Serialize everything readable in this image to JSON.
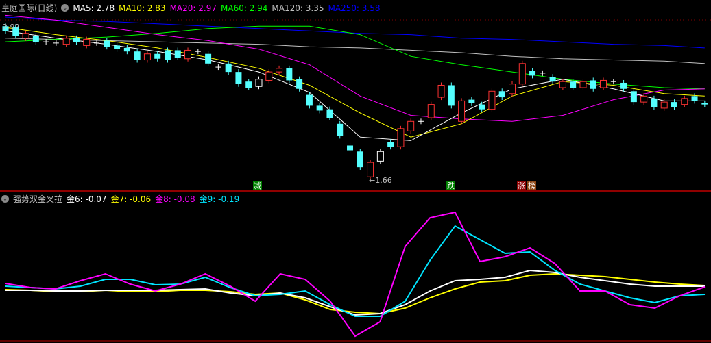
{
  "header": {
    "title": "皇庭国际(日线)",
    "ma": [
      {
        "label": "MA5: 2.78",
        "color": "#ffffff"
      },
      {
        "label": "MA10: 2.83",
        "color": "#ffff00"
      },
      {
        "label": "MA20: 2.97",
        "color": "#ff00ff"
      },
      {
        "label": "MA60: 2.94",
        "color": "#00ff00"
      },
      {
        "label": "MA120: 3.35",
        "color": "#c0c0c0"
      },
      {
        "label": "MA250: 3.58",
        "color": "#0000ff"
      }
    ]
  },
  "price_labels": {
    "high": "2.92",
    "low": "←1.66"
  },
  "markers": [
    {
      "text": "减",
      "bg": "#008000"
    },
    {
      "text": "跌",
      "bg": "#008000"
    },
    {
      "text": "涨",
      "bg": "#8b0000"
    },
    {
      "text": "榜",
      "bg": "#8b4513"
    }
  ],
  "indicator": {
    "title": "强势双金叉拉",
    "lines": [
      {
        "label": "金6: -0.07",
        "color": "#ffffff"
      },
      {
        "label": "金7: -0.06",
        "color": "#ffff00"
      },
      {
        "label": "金8: -0.08",
        "color": "#ff00ff"
      },
      {
        "label": "金9: -0.19",
        "color": "#00e5ff"
      }
    ]
  },
  "colors": {
    "up": "#ff3232",
    "down": "#54ffff",
    "doji": "#ffffff",
    "separator": "#c00000"
  },
  "price_range": [
    1.55,
    3.05
  ],
  "candles": [
    [
      2.93,
      2.89,
      "d"
    ],
    [
      2.92,
      2.85,
      "d"
    ],
    [
      2.83,
      2.87,
      "u"
    ],
    [
      2.85,
      2.8,
      "d"
    ],
    [
      2.8,
      2.8,
      "x"
    ],
    [
      2.79,
      2.79,
      "x"
    ],
    [
      2.78,
      2.83,
      "u"
    ],
    [
      2.83,
      2.8,
      "d"
    ],
    [
      2.77,
      2.82,
      "u"
    ],
    [
      2.79,
      2.79,
      "x"
    ],
    [
      2.81,
      2.76,
      "d"
    ],
    [
      2.77,
      2.74,
      "d"
    ],
    [
      2.75,
      2.72,
      "d"
    ],
    [
      2.72,
      2.65,
      "d"
    ],
    [
      2.65,
      2.7,
      "u"
    ],
    [
      2.7,
      2.66,
      "d"
    ],
    [
      2.73,
      2.65,
      "d"
    ],
    [
      2.73,
      2.67,
      "d"
    ],
    [
      2.66,
      2.73,
      "u"
    ],
    [
      2.72,
      2.72,
      "x"
    ],
    [
      2.7,
      2.62,
      "d"
    ],
    [
      2.59,
      2.59,
      "x"
    ],
    [
      2.62,
      2.55,
      "d"
    ],
    [
      2.55,
      2.45,
      "d"
    ],
    [
      2.47,
      2.42,
      "d"
    ],
    [
      2.43,
      2.49,
      "w"
    ],
    [
      2.48,
      2.55,
      "u"
    ],
    [
      2.55,
      2.58,
      "u"
    ],
    [
      2.58,
      2.48,
      "d"
    ],
    [
      2.49,
      2.41,
      "d"
    ],
    [
      2.36,
      2.27,
      "d"
    ],
    [
      2.27,
      2.23,
      "d"
    ],
    [
      2.24,
      2.17,
      "d"
    ],
    [
      2.12,
      2.02,
      "d"
    ],
    [
      1.94,
      1.9,
      "d"
    ],
    [
      1.89,
      1.76,
      "d"
    ],
    [
      1.68,
      1.8,
      "u"
    ],
    [
      1.81,
      1.89,
      "w"
    ],
    [
      1.97,
      1.93,
      "d"
    ],
    [
      1.93,
      2.08,
      "u"
    ],
    [
      2.06,
      2.14,
      "u"
    ],
    [
      2.14,
      2.14,
      "x"
    ],
    [
      2.17,
      2.28,
      "u"
    ],
    [
      2.34,
      2.44,
      "u"
    ],
    [
      2.44,
      2.27,
      "d"
    ],
    [
      2.14,
      2.31,
      "u"
    ],
    [
      2.32,
      2.29,
      "d"
    ],
    [
      2.28,
      2.24,
      "d"
    ],
    [
      2.24,
      2.39,
      "u"
    ],
    [
      2.39,
      2.34,
      "d"
    ],
    [
      2.37,
      2.45,
      "u"
    ],
    [
      2.45,
      2.62,
      "u"
    ],
    [
      2.56,
      2.52,
      "d"
    ],
    [
      2.54,
      2.54,
      "x"
    ],
    [
      2.51,
      2.47,
      "d"
    ],
    [
      2.42,
      2.47,
      "u"
    ],
    [
      2.47,
      2.42,
      "d"
    ],
    [
      2.42,
      2.47,
      "u"
    ],
    [
      2.48,
      2.41,
      "d"
    ],
    [
      2.42,
      2.48,
      "u"
    ],
    [
      2.47,
      2.47,
      "x"
    ],
    [
      2.46,
      2.41,
      "d"
    ],
    [
      2.39,
      2.3,
      "d"
    ],
    [
      2.3,
      2.35,
      "u"
    ],
    [
      2.33,
      2.26,
      "d"
    ],
    [
      2.25,
      2.3,
      "u"
    ],
    [
      2.3,
      2.26,
      "d"
    ],
    [
      2.28,
      2.33,
      "u"
    ],
    [
      2.35,
      2.31,
      "d"
    ],
    [
      2.29,
      2.28,
      "d"
    ]
  ],
  "ma_sample_index": [
    0,
    5,
    10,
    15,
    20,
    25,
    30,
    35,
    40,
    45,
    50,
    55,
    60,
    65,
    69
  ],
  "ma_series": [
    {
      "name": "MA250",
      "color": "#0000ff",
      "values": [
        3.005,
        2.98,
        2.97,
        2.95,
        2.93,
        2.91,
        2.89,
        2.87,
        2.86,
        2.83,
        2.82,
        2.8,
        2.78,
        2.77,
        2.75
      ]
    },
    {
      "name": "MA120",
      "color": "#c0c0c0",
      "values": [
        2.83,
        2.82,
        2.81,
        2.8,
        2.79,
        2.78,
        2.76,
        2.75,
        2.73,
        2.71,
        2.68,
        2.66,
        2.65,
        2.64,
        2.62
      ]
    },
    {
      "name": "MA60",
      "color": "#00ff00",
      "values": [
        2.8,
        2.82,
        2.84,
        2.87,
        2.91,
        2.93,
        2.93,
        2.86,
        2.68,
        2.61,
        2.55,
        2.49,
        2.45,
        2.42,
        2.41
      ]
    },
    {
      "name": "MA20",
      "color": "#ff00ff",
      "values": [
        3.02,
        2.98,
        2.92,
        2.86,
        2.81,
        2.74,
        2.61,
        2.35,
        2.19,
        2.16,
        2.14,
        2.19,
        2.32,
        2.4,
        2.41
      ]
    },
    {
      "name": "MA10",
      "color": "#ffff00",
      "values": [
        2.92,
        2.86,
        2.81,
        2.75,
        2.67,
        2.58,
        2.44,
        2.21,
        2.01,
        2.12,
        2.35,
        2.47,
        2.44,
        2.37,
        2.35
      ]
    },
    {
      "name": "MA5",
      "color": "#ffffff",
      "values": [
        2.89,
        2.83,
        2.78,
        2.72,
        2.65,
        2.55,
        2.38,
        2.01,
        1.98,
        2.21,
        2.41,
        2.49,
        2.41,
        2.31,
        2.31
      ]
    }
  ],
  "indicator_series": [
    {
      "name": "金7",
      "color": "#ffff00",
      "values": [
        -0.12,
        -0.13,
        -0.15,
        -0.15,
        -0.13,
        -0.15,
        -0.15,
        -0.13,
        -0.13,
        -0.15,
        -0.19,
        -0.17,
        -0.27,
        -0.41,
        -0.45,
        -0.47,
        -0.39,
        -0.24,
        -0.11,
        -0.01,
        0.01,
        0.09,
        0.11,
        0.09,
        0.07,
        0.03,
        -0.01,
        -0.04,
        -0.06
      ]
    },
    {
      "name": "金6",
      "color": "#ffffff",
      "values": [
        -0.13,
        -0.13,
        -0.14,
        -0.14,
        -0.13,
        -0.13,
        -0.13,
        -0.12,
        -0.11,
        -0.17,
        -0.21,
        -0.17,
        -0.24,
        -0.37,
        -0.49,
        -0.47,
        -0.34,
        -0.14,
        0.01,
        0.03,
        0.06,
        0.16,
        0.13,
        0.06,
        0.01,
        -0.04,
        -0.07,
        -0.07,
        -0.07
      ]
    },
    {
      "name": "金9",
      "color": "#00e5ff",
      "values": [
        -0.07,
        -0.09,
        -0.11,
        -0.07,
        0.03,
        0.03,
        -0.05,
        -0.04,
        0.06,
        -0.09,
        -0.21,
        -0.19,
        -0.14,
        -0.34,
        -0.51,
        -0.51,
        -0.29,
        0.31,
        0.81,
        0.61,
        0.41,
        0.43,
        0.16,
        -0.04,
        -0.14,
        -0.24,
        -0.31,
        -0.21,
        -0.19
      ]
    },
    {
      "name": "金8",
      "color": "#ff00ff",
      "values": [
        -0.03,
        -0.09,
        -0.11,
        0.01,
        0.11,
        -0.04,
        -0.14,
        -0.04,
        0.11,
        -0.07,
        -0.29,
        0.11,
        0.03,
        -0.29,
        -0.8,
        -0.59,
        0.51,
        0.93,
        1.01,
        0.29,
        0.36,
        0.49,
        0.26,
        -0.14,
        -0.14,
        -0.34,
        -0.39,
        -0.21,
        -0.08
      ]
    }
  ]
}
